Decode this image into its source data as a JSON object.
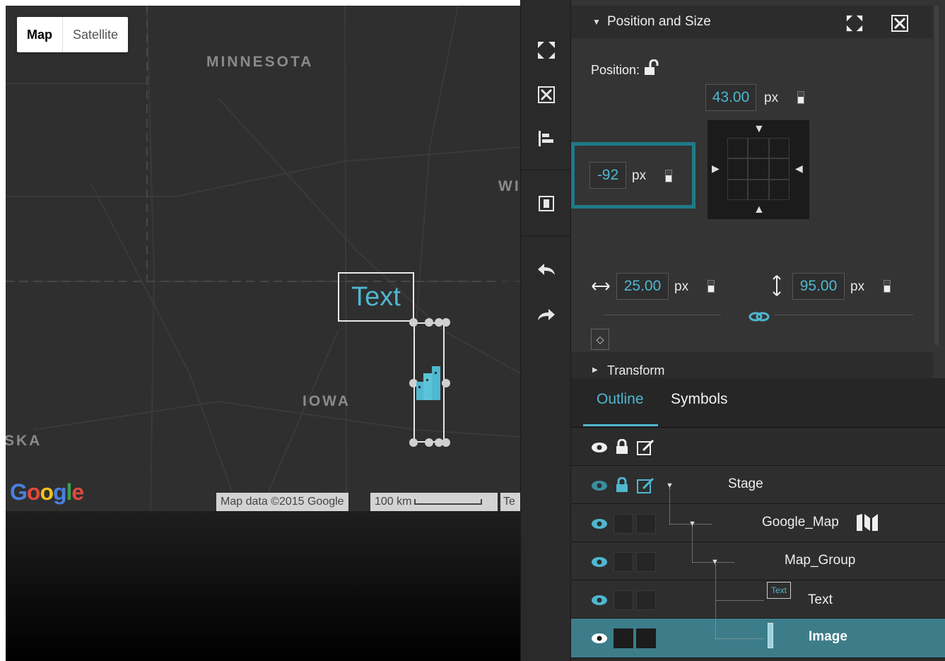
{
  "map": {
    "map_type_buttons": [
      "Map",
      "Satellite"
    ],
    "states": [
      "MINNESOTA",
      "IOWA",
      "SKA",
      "WI"
    ],
    "google_logo": "Google",
    "attribution": "Map data ©2015 Google",
    "scale": "100 km",
    "terms_partial": "Te",
    "text_element": "Text"
  },
  "properties": {
    "section_title": "Position and Size",
    "position_label": "Position:",
    "top": "43.00",
    "left": "-92",
    "width": "25.00",
    "height": "95.00",
    "unit": "px",
    "transform_title": "Transform"
  },
  "outline": {
    "tabs": [
      "Outline",
      "Symbols"
    ],
    "rows": [
      {
        "name": "Stage"
      },
      {
        "name": "Google_Map"
      },
      {
        "name": "Map_Group"
      },
      {
        "name": "Text",
        "thumb": "Text"
      },
      {
        "name": "Image"
      }
    ]
  },
  "colors": {
    "accent": "#4fb7cf",
    "selected_row": "#3d7d8a",
    "highlight_border": "#1f7a88"
  }
}
